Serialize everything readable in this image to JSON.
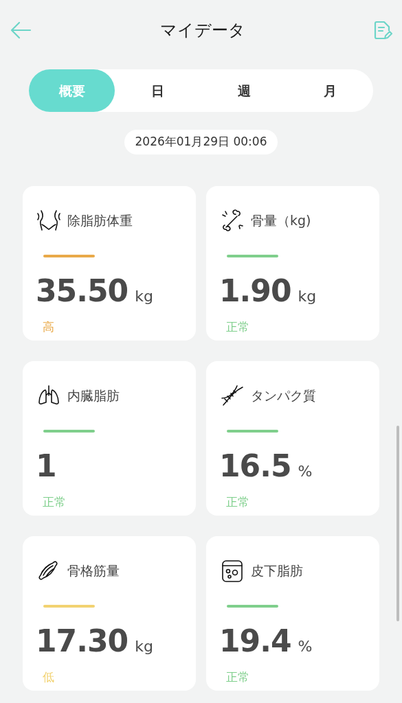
{
  "header": {
    "title": "マイデータ"
  },
  "tabs": [
    {
      "label": "概要",
      "selected": true
    },
    {
      "label": "日",
      "selected": false
    },
    {
      "label": "週",
      "selected": false
    },
    {
      "label": "月",
      "selected": false
    }
  ],
  "date": "2026年01月29日 00:06",
  "metrics": [
    {
      "name": "除脂肪体重",
      "value": "35.50",
      "unit": "kg",
      "status": "高",
      "color": "#e9a948"
    },
    {
      "name": "骨量（kg)",
      "value": "1.90",
      "unit": "kg",
      "status": "正常",
      "color": "#7fcf8c"
    },
    {
      "name": "内臓脂肪",
      "value": "1",
      "status": "正常",
      "color": "#7fcf8c"
    },
    {
      "name": "タンパク質",
      "value": "16.5",
      "unit": "%",
      "status": "正常",
      "color": "#7fcf8c"
    },
    {
      "name": "骨格筋量",
      "value": "17.30",
      "unit": "kg",
      "status": "低",
      "color": "#f2d271"
    },
    {
      "name": "皮下脂肪",
      "value": "19.4",
      "unit": "%",
      "status": "正常",
      "color": "#7fcf8c"
    }
  ]
}
